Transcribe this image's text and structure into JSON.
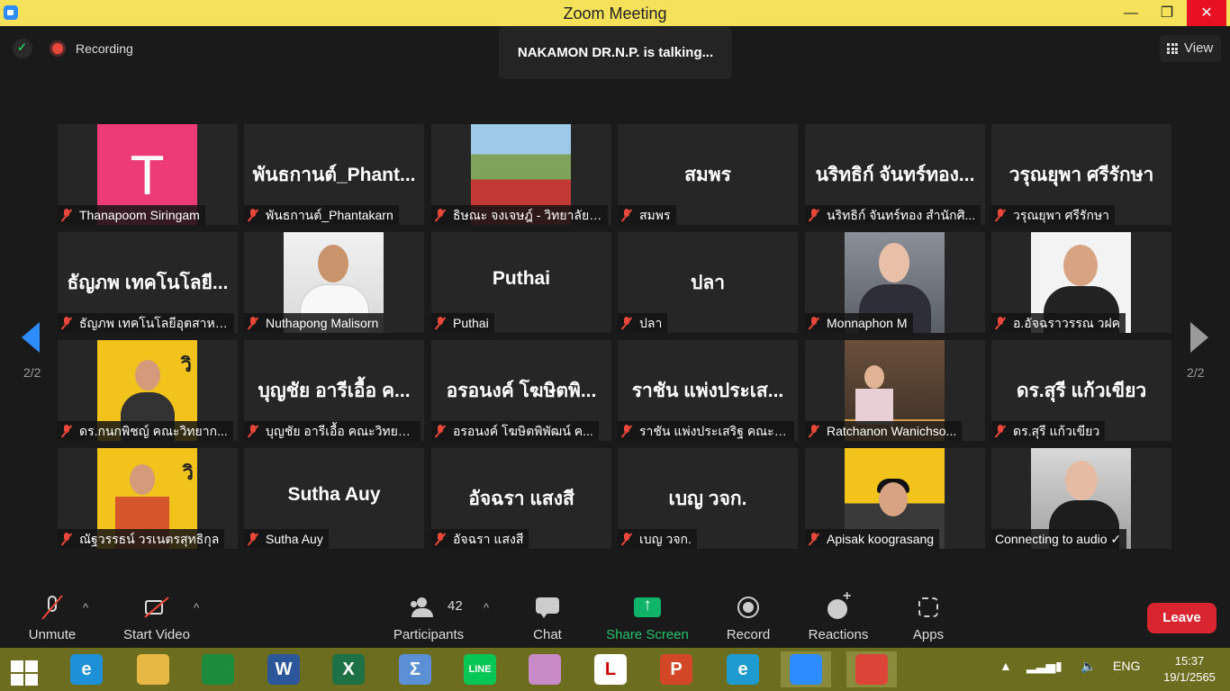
{
  "window": {
    "title": "Zoom Meeting",
    "minimize": "—",
    "maximize": "❐",
    "close": "✕"
  },
  "meeting": {
    "recording_label": "Recording",
    "talking_banner": "NAKAMON DR.N.P. is talking...",
    "view_label": "View",
    "page_left": "2/2",
    "page_right": "2/2"
  },
  "tiles": [
    {
      "name": "Thanapoom Siringam",
      "display": "T",
      "photo": "pink"
    },
    {
      "name": "พันธกานต์_Phantakarn",
      "display": "พันธกานต์_Phant...",
      "photo": ""
    },
    {
      "name": "ธิษณะ จงเจษฎ์ - วิทยาลัยก...",
      "display": "",
      "photo": "outdoor"
    },
    {
      "name": "สมพร",
      "display": "สมพร",
      "photo": ""
    },
    {
      "name": "นริทธิก์ จันทร์ทอง สำนักศิ...",
      "display": "นริทธิก์ จันทร์ทอง...",
      "photo": ""
    },
    {
      "name": "วรุณยุพา ศรีรักษา",
      "display": "วรุณยุพา ศรีรักษา",
      "photo": ""
    },
    {
      "name": "ธัญภพ เทคโนโลยีอุตสาหก...",
      "display": "ธัญภพ เทคโนโลยี...",
      "photo": ""
    },
    {
      "name": "Nuthapong Malisorn",
      "display": "",
      "photo": "white"
    },
    {
      "name": "Puthai",
      "display": "Puthai",
      "photo": ""
    },
    {
      "name": "ปลา",
      "display": "ปลา",
      "photo": ""
    },
    {
      "name": "Monnaphon M",
      "display": "",
      "photo": "room"
    },
    {
      "name": "อ.อัจฉราวรรณ วฝค",
      "display": "",
      "photo": "portrait"
    },
    {
      "name": "ดร.กนกพิชญ์ คณะวิทยาก...",
      "display": "",
      "photo": "yellow"
    },
    {
      "name": "บุญชัย อารีเอื้อ คณะวิทยาศ...",
      "display": "บุญชัย อารีเอื้อ ค...",
      "photo": ""
    },
    {
      "name": "อรอนงค์ โฆษิตพิพัฒน์ ค...",
      "display": "อรอนงค์ โฆษิตพิ...",
      "photo": ""
    },
    {
      "name": "ราชัน แพ่งประเสริฐ คณะเท...",
      "display": "ราชัน แพ่งประเส...",
      "photo": ""
    },
    {
      "name": "Ratchanon Wanichso...",
      "display": "",
      "photo": "cafe"
    },
    {
      "name": "ดร.สุรี แก้วเขียว",
      "display": "ดร.สุรี แก้วเขียว",
      "photo": ""
    },
    {
      "name": "ณัฐวรรธน์ วรเนตรสุทธิกุล",
      "display": "",
      "photo": "yellow2"
    },
    {
      "name": "Sutha Auy",
      "display": "Sutha Auy",
      "photo": ""
    },
    {
      "name": "อัจฉรา แสงสี",
      "display": "อัจฉรา แสงสี",
      "photo": ""
    },
    {
      "name": "เบญ วจก.",
      "display": "เบญ วจก.",
      "photo": ""
    },
    {
      "name": "Apisak koograsang",
      "display": "",
      "photo": "yellow3"
    },
    {
      "name": "Connecting to audio ✓",
      "display": "",
      "photo": "office",
      "no_mic": true
    }
  ],
  "toolbar": {
    "unmute": "Unmute",
    "start_video": "Start Video",
    "participants": "Participants",
    "participants_count": "42",
    "chat": "Chat",
    "share_screen": "Share Screen",
    "record": "Record",
    "reactions": "Reactions",
    "apps": "Apps",
    "leave": "Leave",
    "caret": "^"
  },
  "taskbar": {
    "apps": [
      {
        "icon": "start-icon"
      },
      {
        "icon": "internet-explorer-icon",
        "glyph": "e",
        "color": "#1e90d8"
      },
      {
        "icon": "file-explorer-icon",
        "glyph": "",
        "color": "#e8b845"
      },
      {
        "icon": "store-icon",
        "glyph": "",
        "color": "#1b8b3c"
      },
      {
        "icon": "word-icon",
        "glyph": "W",
        "color": "#2b579a"
      },
      {
        "icon": "excel-icon",
        "glyph": "X",
        "color": "#1e7145"
      },
      {
        "icon": "math-input-icon",
        "glyph": "Σ",
        "color": "#5b8fd6"
      },
      {
        "icon": "line-icon",
        "glyph": "LINE",
        "color": "#06c755"
      },
      {
        "icon": "paint-icon",
        "glyph": "",
        "color": "#c98ac8"
      },
      {
        "icon": "lisrel-icon",
        "glyph": "L",
        "color": "#ffffff"
      },
      {
        "icon": "powerpoint-icon",
        "glyph": "P",
        "color": "#d24726"
      },
      {
        "icon": "edge-icon",
        "glyph": "e",
        "color": "#1d9bd1"
      },
      {
        "icon": "zoom-icon",
        "glyph": "",
        "color": "#2d8cff"
      },
      {
        "icon": "chrome-icon",
        "glyph": "",
        "color": "#db4437"
      }
    ],
    "language": "ENG",
    "time": "15:37",
    "date": "19/1/2565"
  },
  "colors": {
    "title_bar": "#f5e25a",
    "meeting_bg": "#1a1a1a",
    "tile_bg": "#262626",
    "muted_red": "#e8473a",
    "share_green": "#0fb468",
    "leave_red": "#d9252f",
    "accent_blue": "#2d8cff",
    "taskbar": "#6d6d1f"
  }
}
